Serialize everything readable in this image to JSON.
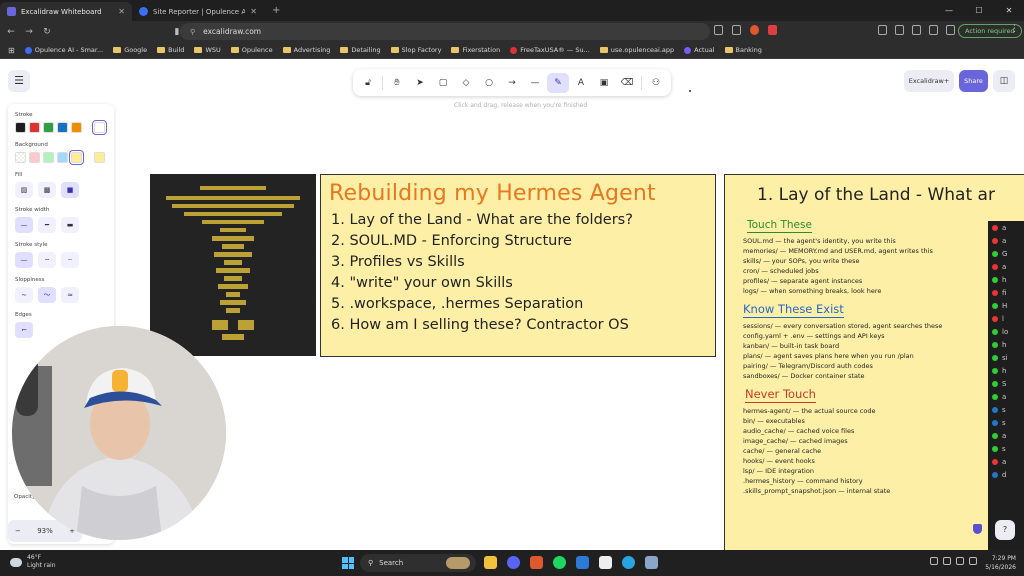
{
  "browser": {
    "tabs": [
      {
        "title": "Excalidraw Whiteboard",
        "active": true
      },
      {
        "title": "Site Reporter | Opulence AI",
        "active": false
      }
    ],
    "url": "excalidraw.com",
    "action_label": "Action required",
    "bookmarks": [
      "Opulence AI - Smar...",
      "Google",
      "Build",
      "WSU",
      "Opulence",
      "Advertising",
      "Detailing",
      "Slop Factory",
      "Fixerstation",
      "FreeTaxUSA® — Su...",
      "use.opulenceai.app",
      "Actual",
      "Banking"
    ]
  },
  "toolbar": {
    "hint": "Click and drag, release when you're finished",
    "tools": [
      "lock-icon",
      "hand-icon",
      "selection-icon",
      "rectangle-icon",
      "diamond-icon",
      "ellipse-icon",
      "arrow-icon",
      "line-icon",
      "draw-icon",
      "text-icon",
      "image-icon",
      "eraser-icon",
      "extra-tools-icon"
    ],
    "active_tool": "draw-icon"
  },
  "top_right": {
    "library_label": "Excalidraw+",
    "share_label": "Share"
  },
  "properties": {
    "stroke_label": "Stroke",
    "background_label": "Background",
    "fill_label": "Fill",
    "stroke_width_label": "Stroke width",
    "stroke_style_label": "Stroke style",
    "sloppiness_label": "Sloppiness",
    "edges_label": "Edges",
    "opacity_label": "Opacity",
    "stroke_colors": [
      "#1e1e1e",
      "#e03131",
      "#2f9e44",
      "#1971c2",
      "#f08c00"
    ],
    "background_colors": [
      "#ffffff",
      "#ffc9c9",
      "#b2f2bb",
      "#a5d8ff",
      "#ffec99"
    ],
    "current_stroke": "#ffffff",
    "current_background": "#ffec99"
  },
  "zoom": {
    "level": "93%"
  },
  "slide1": {
    "title": "Rebuilding my Hermes Agent",
    "items": [
      "1. Lay of the Land - What are the folders?",
      "2. SOUL.MD - Enforcing Structure",
      "3. Profiles vs Skills",
      "4. \"write\" your own Skills",
      "5. .workspace, .hermes Separation",
      "6. How am I selling these? Contractor OS"
    ]
  },
  "slide2": {
    "title": "1. Lay of the Land - What ar",
    "touch_heading": "Touch These",
    "touch_items": [
      "SOUL.md — the agent's identity, you write this",
      "memories/ — MEMORY.md and USER.md, agent writes this",
      "skills/ — your SOPs, you write these",
      "cron/ — scheduled jobs",
      "profiles/ — separate agent instances",
      "logs/ — when something breaks, look here"
    ],
    "know_heading": "Know These Exist",
    "know_items": [
      "sessions/ — every conversation stored, agent searches these",
      "config.yaml + .env — settings and API keys",
      "kanban/ — built-in task board",
      "plans/ — agent saves plans here when you run /plan",
      "pairing/ — Telegram/Discord auth codes",
      "sandboxes/ — Docker container state"
    ],
    "never_heading": "Never Touch",
    "never_items": [
      "hermes-agent/ — the actual source code",
      "bin/ — executables",
      "audio_cache/ — cached voice files",
      "image_cache/ — cached images",
      "cache/ — general cache",
      "hooks/ — event hooks",
      "lsp/ — IDE integration",
      ".hermes_history — command history",
      ".skills_prompt_snapshot.json — internal state"
    ]
  },
  "overlay_window": {
    "letters": [
      "a",
      "a",
      "G",
      "a",
      "h",
      "fi",
      "H",
      "l",
      "lo",
      "h",
      "si",
      "h",
      "S",
      "a",
      "s",
      "s",
      "a",
      "s",
      "a",
      "d"
    ]
  },
  "taskbar": {
    "weather_temp": "46°F",
    "weather_desc": "Light rain",
    "search_label": "Search",
    "time": "7:29 PM",
    "date": "5/16/2026"
  },
  "colors": {
    "accent": "#6965db",
    "slide_bg": "#fdf0a6",
    "title_orange": "#e8771e"
  }
}
